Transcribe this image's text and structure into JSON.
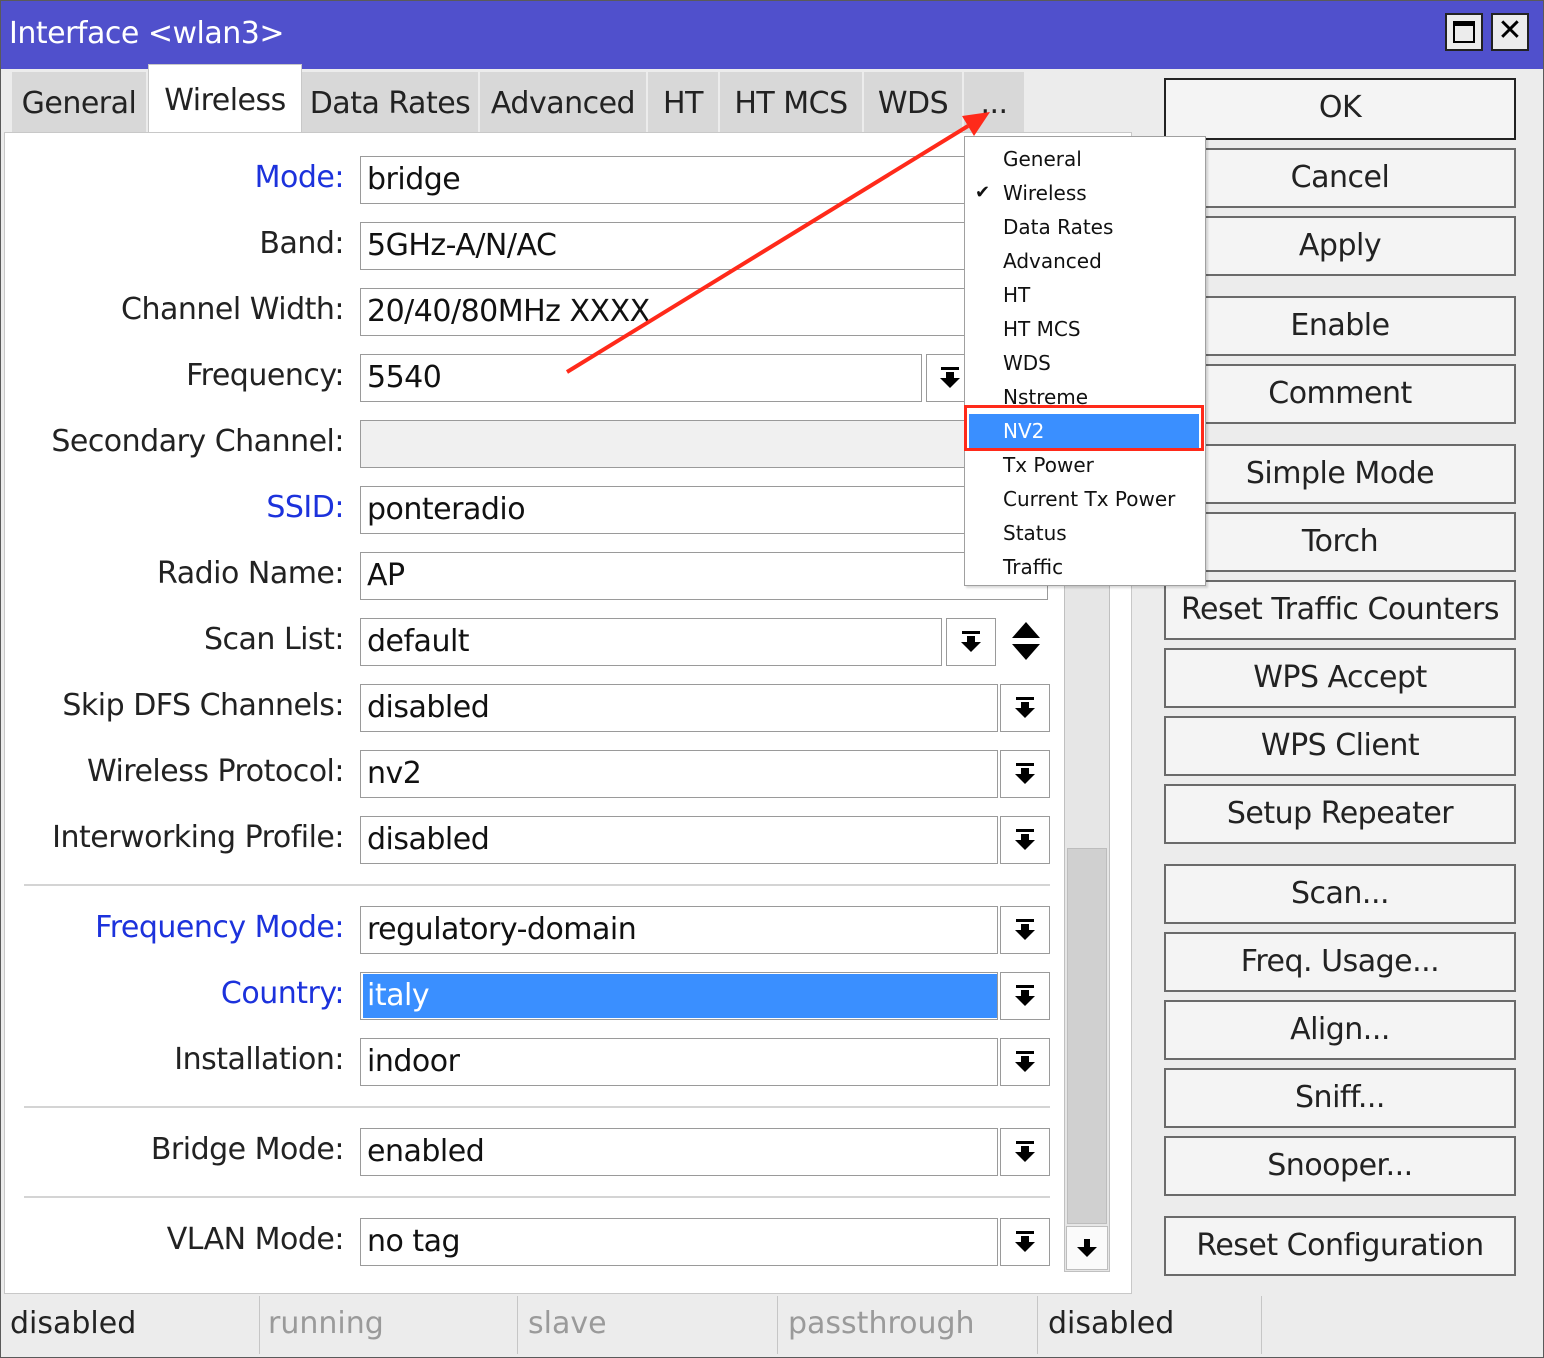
{
  "window": {
    "title": "Interface <wlan3>"
  },
  "tabs": [
    {
      "label": "General"
    },
    {
      "label": "Wireless"
    },
    {
      "label": "Data Rates"
    },
    {
      "label": "Advanced"
    },
    {
      "label": "HT"
    },
    {
      "label": "HT MCS"
    },
    {
      "label": "WDS"
    },
    {
      "label": "..."
    }
  ],
  "form": {
    "mode": {
      "label": "Mode:",
      "value": "bridge"
    },
    "band": {
      "label": "Band:",
      "value": "5GHz-A/N/AC"
    },
    "channel_width": {
      "label": "Channel Width:",
      "value": "20/40/80MHz XXXX"
    },
    "frequency": {
      "label": "Frequency:",
      "value": "5540"
    },
    "secondary_channel": {
      "label": "Secondary Channel:",
      "value": ""
    },
    "ssid": {
      "label": "SSID:",
      "value": "ponteradio"
    },
    "radio_name": {
      "label": "Radio Name:",
      "value": "AP"
    },
    "scan_list": {
      "label": "Scan List:",
      "value": "default"
    },
    "skip_dfs": {
      "label": "Skip DFS Channels:",
      "value": "disabled"
    },
    "wireless_protocol": {
      "label": "Wireless Protocol:",
      "value": "nv2"
    },
    "interworking_profile": {
      "label": "Interworking Profile:",
      "value": "disabled"
    },
    "frequency_mode": {
      "label": "Frequency Mode:",
      "value": "regulatory-domain"
    },
    "country": {
      "label": "Country:",
      "value": "italy"
    },
    "installation": {
      "label": "Installation:",
      "value": "indoor"
    },
    "bridge_mode": {
      "label": "Bridge Mode:",
      "value": "enabled"
    },
    "vlan_mode": {
      "label": "VLAN Mode:",
      "value": "no tag"
    }
  },
  "buttons": {
    "ok": "OK",
    "cancel": "Cancel",
    "apply": "Apply",
    "enable": "Enable",
    "comment": "Comment",
    "simple_mode": "Simple Mode",
    "torch": "Torch",
    "reset_traffic": "Reset Traffic Counters",
    "wps_accept": "WPS Accept",
    "wps_client": "WPS Client",
    "setup_repeater": "Setup Repeater",
    "scan": "Scan...",
    "freq_usage": "Freq. Usage...",
    "align": "Align...",
    "sniff": "Sniff...",
    "snooper": "Snooper...",
    "reset_config": "Reset Configuration"
  },
  "menu": {
    "items": [
      "General",
      "Wireless",
      "Data Rates",
      "Advanced",
      "HT",
      "HT MCS",
      "WDS",
      "Nstreme",
      "NV2",
      "Tx Power",
      "Current Tx Power",
      "Status",
      "Traffic"
    ],
    "checked": "Wireless",
    "highlighted": "NV2"
  },
  "status": [
    "disabled",
    "running",
    "slave",
    "passthrough",
    "disabled"
  ],
  "colors": {
    "titlebar": "#5050cc",
    "link_label": "#1c32dc",
    "selection": "#3a8fff",
    "annotation": "#ff2a1a"
  }
}
